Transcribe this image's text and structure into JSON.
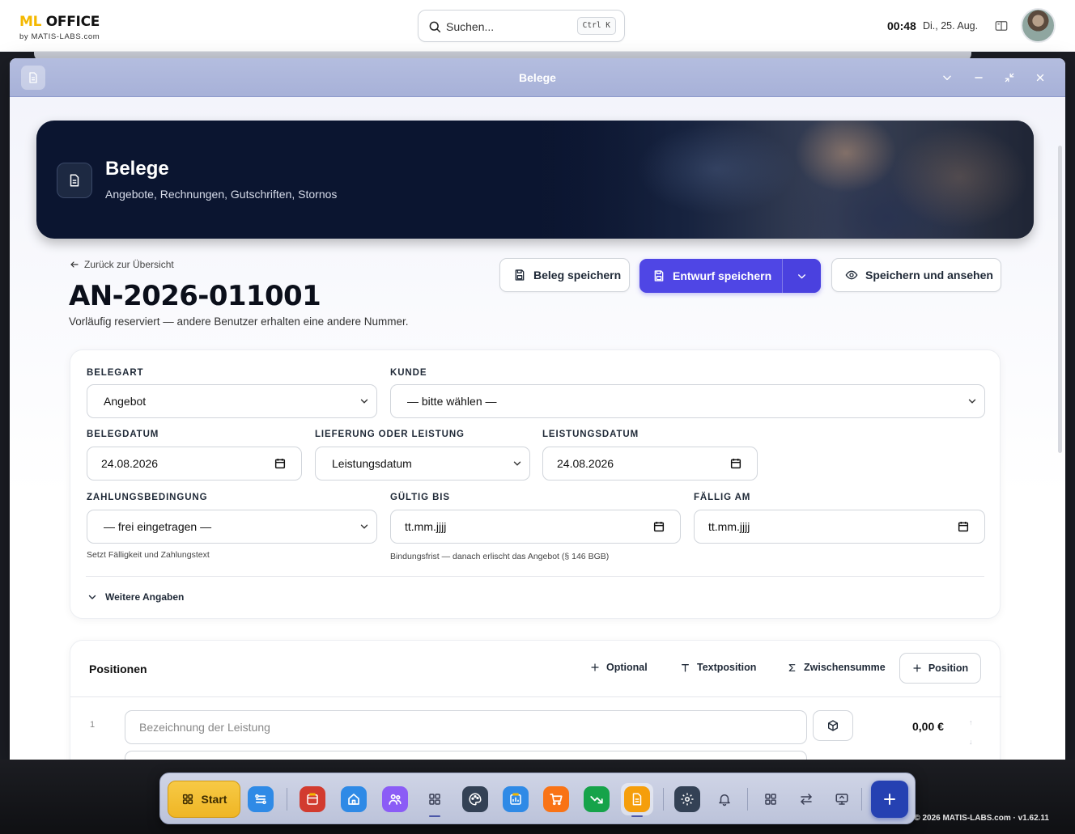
{
  "topbar": {
    "logo_accent": "ML",
    "logo_main": " OFFICE",
    "logo_sub": "by MATIS-LABS.com",
    "search_placeholder": "Suchen...",
    "search_shortcut": "Ctrl K",
    "time": "00:48",
    "date": "Di., 25. Aug."
  },
  "window": {
    "title": "Belege"
  },
  "hero": {
    "title": "Belege",
    "subtitle": "Angebote, Rechnungen, Gutschriften, Stornos"
  },
  "document": {
    "back_label": "Zurück zur Übersicht",
    "number": "AN-2026-011001",
    "note": "Vorläufig reserviert — andere Benutzer erhalten eine andere Nummer."
  },
  "actions": {
    "save": "Beleg speichern",
    "save_draft": "Entwurf speichern",
    "save_view": "Speichern und ansehen"
  },
  "form": {
    "belegart_label": "BELEGART",
    "belegart_value": "Angebot",
    "kunde_label": "KUNDE",
    "kunde_value": "— bitte wählen —",
    "belegdatum_label": "BELEGDATUM",
    "belegdatum_value": "24.08.2026",
    "lieferung_label": "LIEFERUNG ODER LEISTUNG",
    "lieferung_value": "Leistungsdatum",
    "leistungsdatum_label": "LEISTUNGSDATUM",
    "leistungsdatum_value": "24.08.2026",
    "zahlung_label": "ZAHLUNGSBEDINGUNG",
    "zahlung_value": "— frei eingetragen —",
    "zahlung_hint": "Setzt Fälligkeit und Zahlungstext",
    "gueltig_label": "GÜLTIG BIS",
    "gueltig_value": "tt.mm.jjjj",
    "gueltig_hint": "Bindungsfrist — danach erlischt das Angebot (§ 146 BGB)",
    "faellig_label": "FÄLLIG AM",
    "faellig_value": "tt.mm.jjjj",
    "more_label": "Weitere Angaben"
  },
  "positions": {
    "title": "Positionen",
    "optional": "Optional",
    "textposition": "Textposition",
    "zwischensumme": "Zwischensumme",
    "add_position": "Position",
    "rows": [
      {
        "num": "1",
        "placeholder": "Bezeichnung der Leistung",
        "amount": "0,00 €"
      }
    ]
  },
  "taskbar": {
    "start_label": "Start",
    "accent_color": "#f4b800",
    "primary_color": "#4f46e5"
  },
  "footer": {
    "copyright": "© 2026 MATIS-LABS.com · v1.62.11"
  }
}
